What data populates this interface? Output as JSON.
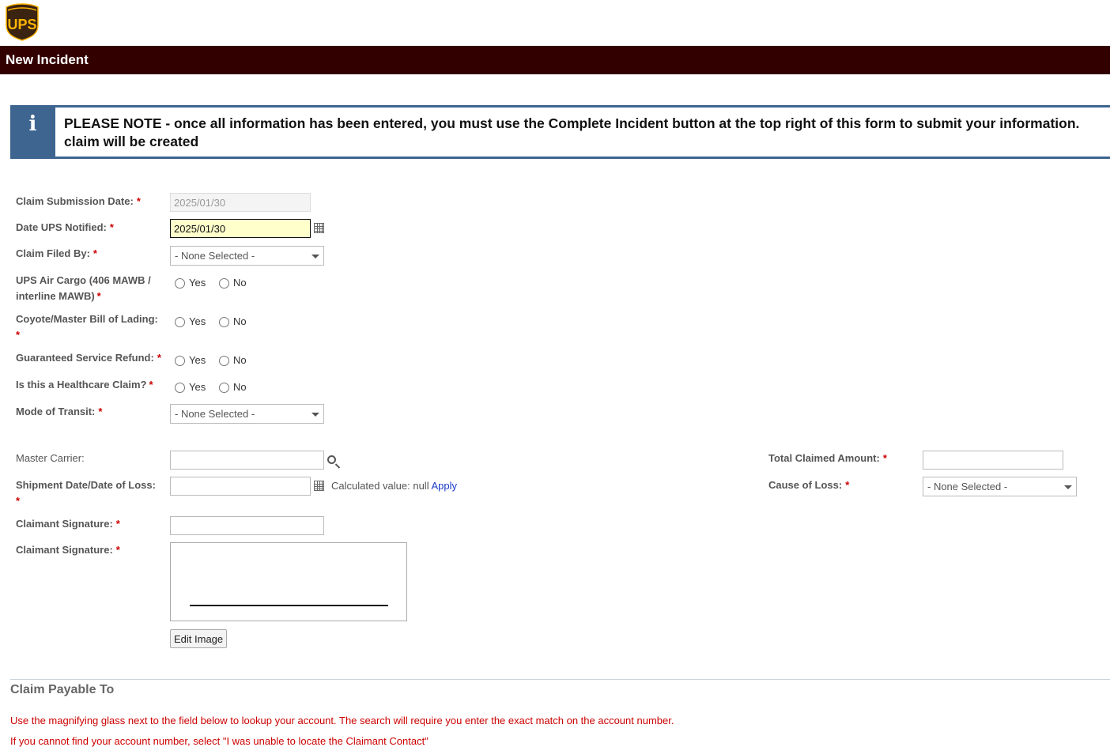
{
  "header": {
    "logo_text": "UPS",
    "title": "New Incident"
  },
  "note": {
    "icon": "info-icon",
    "line1": "PLEASE NOTE - once all information has been entered, you must use the Complete Incident button at the top right of this form to submit your information.",
    "line2": "claim will be created"
  },
  "form": {
    "claim_submission_date": {
      "label": "Claim Submission Date:",
      "value": "2025/01/30"
    },
    "date_ups_notified": {
      "label": "Date UPS Notified:",
      "value": "2025/01/30"
    },
    "claim_filed_by": {
      "label": "Claim Filed By:",
      "value": "- None Selected -"
    },
    "air_cargo": {
      "label_line1": "UPS Air Cargo (406 MAWB /",
      "label_line2": "interline MAWB)",
      "yes": "Yes",
      "no": "No"
    },
    "coyote": {
      "label": "Coyote/Master Bill of Lading:",
      "yes": "Yes",
      "no": "No"
    },
    "guaranteed_refund": {
      "label": "Guaranteed Service Refund:",
      "yes": "Yes",
      "no": "No"
    },
    "healthcare": {
      "label": "Is this a Healthcare Claim?",
      "yes": "Yes",
      "no": "No"
    },
    "mode_of_transit": {
      "label": "Mode of Transit:",
      "value": "- None Selected -"
    },
    "master_carrier": {
      "label": "Master Carrier:",
      "value": ""
    },
    "shipment_date": {
      "label": "Shipment Date/Date of Loss:",
      "value": "",
      "calc_prefix": "Calculated value: null",
      "apply": "Apply"
    },
    "claimant_signature_text": {
      "label": "Claimant Signature:",
      "value": ""
    },
    "claimant_signature_image": {
      "label": "Claimant Signature:",
      "edit_button": "Edit Image"
    },
    "total_claimed_amount": {
      "label": "Total Claimed Amount:",
      "value": ""
    },
    "cause_of_loss": {
      "label": "Cause of Loss:",
      "value": "- None Selected -"
    },
    "required_mark": "*"
  },
  "payable": {
    "title": "Claim Payable To",
    "instruction1": "Use the magnifying glass next to the field below to lookup your account. The search will require you enter the exact match on the account number.",
    "instruction2": "If you cannot find your account number, select \"I was unable to locate the Claimant Contact\""
  }
}
